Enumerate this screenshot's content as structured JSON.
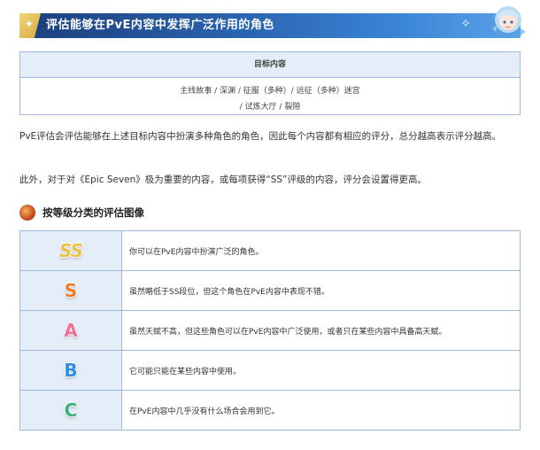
{
  "banner": {
    "title": "评估能够在PvE内容中发挥广泛作用的角色",
    "accent_color": "#2a64b0"
  },
  "target": {
    "header": "目标内容",
    "line1": "主线故事 / 深渊 / 征服（多种）/ 远征（多种）迷宫",
    "line2": "/ 试炼大厅 / 裂隙"
  },
  "paragraphs": [
    "PvE评估会评估能够在上述目标内容中扮演多种角色的角色，因此每个内容都有相应的评分，总分越高表示评分越高。",
    "此外，对于对《Epic Seven》极为重要的内容，或每项获得“SS”评级的内容，评分会设置得更高。"
  ],
  "section_heading": "按等级分类的评估图像",
  "grades": [
    {
      "grade": "SS",
      "color": "#e8c14a",
      "description": "你可以在PvE内容中扮演广泛的角色。"
    },
    {
      "grade": "S",
      "color": "#f07a2a",
      "description": "虽然略低于SS段位，但这个角色在PvE内容中表现不错。"
    },
    {
      "grade": "A",
      "color": "#f0709a",
      "description": "虽然天赋不高，但这些角色可以在PvE内容中广泛使用，或者只在某些内容中具备高天赋。"
    },
    {
      "grade": "B",
      "color": "#2f8ee6",
      "description": "它可能只能在某些内容中使用。"
    },
    {
      "grade": "C",
      "color": "#3bb07a",
      "description": "在PvE内容中几乎没有什么场合会用到它。"
    }
  ]
}
